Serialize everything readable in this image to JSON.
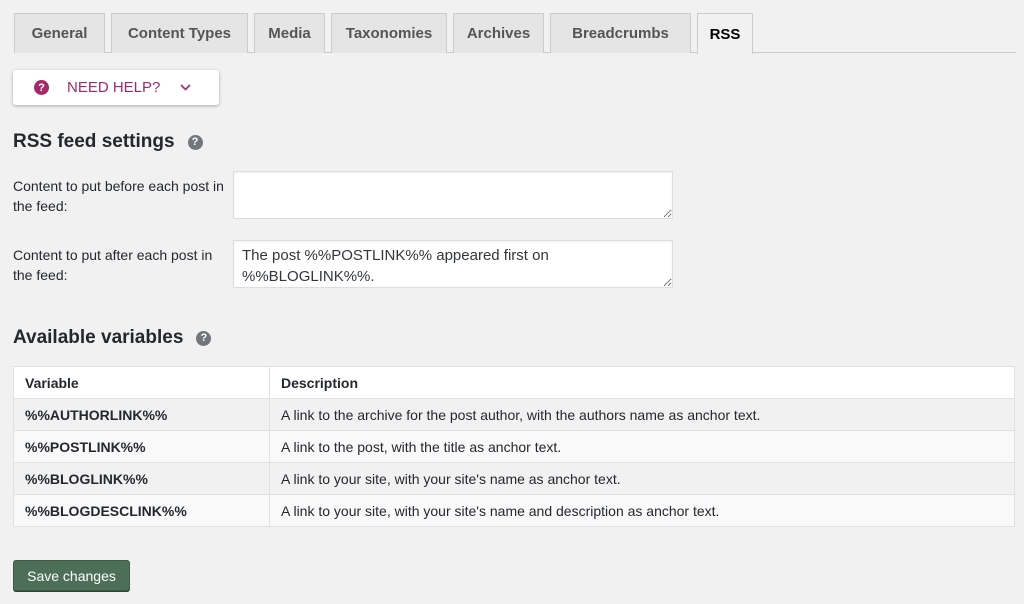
{
  "tabs": [
    {
      "label": "General"
    },
    {
      "label": "Content Types"
    },
    {
      "label": "Media"
    },
    {
      "label": "Taxonomies"
    },
    {
      "label": "Archives"
    },
    {
      "label": "Breadcrumbs"
    },
    {
      "label": "RSS",
      "active": true
    }
  ],
  "help": {
    "label": "NEED HELP?",
    "icon": "question-circle-icon",
    "chevron": "chevron-down-icon"
  },
  "rss": {
    "title": "RSS feed settings",
    "before_label": "Content to put before each post in the feed:",
    "before_value": "",
    "after_label": "Content to put after each post in the feed:",
    "after_value": "The post %%POSTLINK%% appeared first on %%BLOGLINK%%."
  },
  "variables": {
    "title": "Available variables",
    "headers": [
      "Variable",
      "Description"
    ],
    "rows": [
      [
        "%%AUTHORLINK%%",
        "A link to the archive for the post author, with the authors name as anchor text."
      ],
      [
        "%%POSTLINK%%",
        "A link to the post, with the title as anchor text."
      ],
      [
        "%%BLOGLINK%%",
        "A link to your site, with your site's name as anchor text."
      ],
      [
        "%%BLOGDESCLINK%%",
        "A link to your site, with your site's name and description as anchor text."
      ]
    ]
  },
  "save_label": "Save changes",
  "colors": {
    "accent": "#a4286a",
    "save_button": "#4d6e57"
  }
}
